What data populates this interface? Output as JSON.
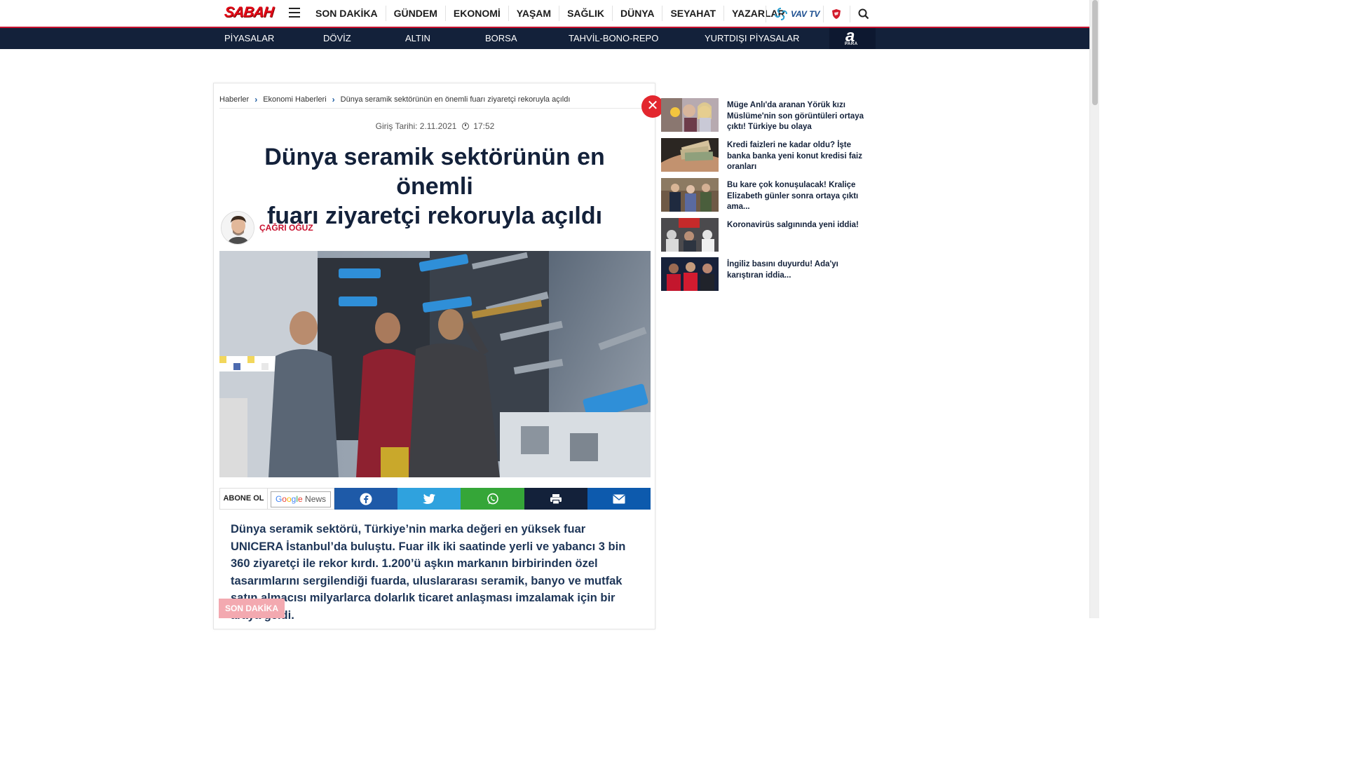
{
  "header": {
    "logo_text": "SABAH",
    "nav": [
      "SON DAKİKA",
      "GÜNDEM",
      "EKONOMİ",
      "YAŞAM",
      "SAĞLIK",
      "DÜNYA",
      "SEYAHAT",
      "YAZARLAR"
    ],
    "vavtv_label": "VAV TV",
    "accent_color": "#c8102e"
  },
  "subnav": {
    "items": [
      "PİYASALAR",
      "DÖVİZ",
      "ALTIN",
      "BORSA",
      "TAHVİL-BONO-REPO",
      "YURTDIŞI PİYASALAR"
    ],
    "apara_letter": "a",
    "apara_sub": "PARA",
    "bg_color": "#13213a"
  },
  "article": {
    "breadcrumb": [
      "Haberler",
      "Ekonomi Haberleri",
      "Dünya seramik sektörünün en önemli fuarı ziyaretçi rekoruyla açıldı"
    ],
    "date_label": "Giriş Tarihi: 2.11.2021",
    "time": "17:52",
    "headline_line1": "Dünya seramik sektörünün en önemli",
    "headline_line2": "fuarı ziyaretçi rekoruyla açıldı",
    "author": "ÇAĞRI OĞUZ",
    "abone_label": "ABONE OL",
    "google_news_label_1": "Google",
    "google_news_label_2": " News",
    "lead": "Dünya seramik sektörü, Türkiye’nin marka değeri en yüksek fuar UNICERA İstanbul’da buluştu. Fuar ilk iki saatinde yerli ve yabancı 3 bin 360 ziyaretçi ile rekor kırdı. 1.200’ü aşkın markanın birbirinden özel tasarımlarını sergilendiği fuarda, uluslararası seramik, banyo ve mutfak satın almacısı milyarlarca dolarlık ticaret anlaşması imzalamak için bir araya geldi.",
    "share_colors": {
      "facebook": "#1e5aa8",
      "twitter": "#2fa2de",
      "whatsapp": "#35a638",
      "print": "#13213a",
      "email": "#0d5aad"
    }
  },
  "sidebar": {
    "items": [
      {
        "title": "Müge Anlı'da aranan Yörük kızı Müslüme'nin son görüntüleri ortaya çıktı! Türkiye bu olaya"
      },
      {
        "title": "Kredi faizleri ne kadar oldu? İşte banka banka yeni konut kredisi faiz oranları"
      },
      {
        "title": "Bu kare çok konuşulacak! Kraliçe Elizabeth günler sonra ortaya çıktı ama..."
      },
      {
        "title": "Koronavirüs salgınında yeni iddia!"
      },
      {
        "title": "İngiliz basını duyurdu! Ada'yı karıştıran iddia..."
      }
    ]
  },
  "footer_tag": "SON DAKİKA"
}
